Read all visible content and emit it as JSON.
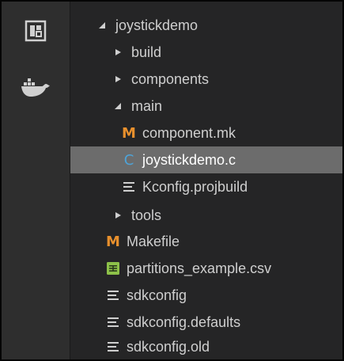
{
  "activity_bar": {
    "icons": [
      "explorer-icon",
      "docker-icon"
    ]
  },
  "tree": {
    "root": {
      "label": "joystickdemo",
      "icon": "chevron-down-icon"
    },
    "items": [
      {
        "label": "build",
        "type": "folder",
        "expanded": false
      },
      {
        "label": "components",
        "type": "folder",
        "expanded": false
      },
      {
        "label": "main",
        "type": "folder",
        "expanded": true
      },
      {
        "label": "component.mk",
        "type": "makefile",
        "icon_glyph": "M"
      },
      {
        "label": "joystickdemo.c",
        "type": "c-file",
        "icon_glyph": "C",
        "selected": true
      },
      {
        "label": "Kconfig.projbuild",
        "type": "text-file"
      },
      {
        "label": "tools",
        "type": "folder",
        "expanded": false
      },
      {
        "label": "Makefile",
        "type": "makefile",
        "icon_glyph": "M"
      },
      {
        "label": "partitions_example.csv",
        "type": "csv-file"
      },
      {
        "label": "sdkconfig",
        "type": "text-file"
      },
      {
        "label": "sdkconfig.defaults",
        "type": "text-file"
      },
      {
        "label": "sdkconfig.old",
        "type": "text-file"
      }
    ]
  },
  "colors": {
    "background": "#252526",
    "activity_bar": "#2e2e2e",
    "selection": "#6c6c6c",
    "makefile_icon": "#e8902d",
    "c_icon": "#4ea3d8",
    "csv_icon": "#8dc149"
  }
}
